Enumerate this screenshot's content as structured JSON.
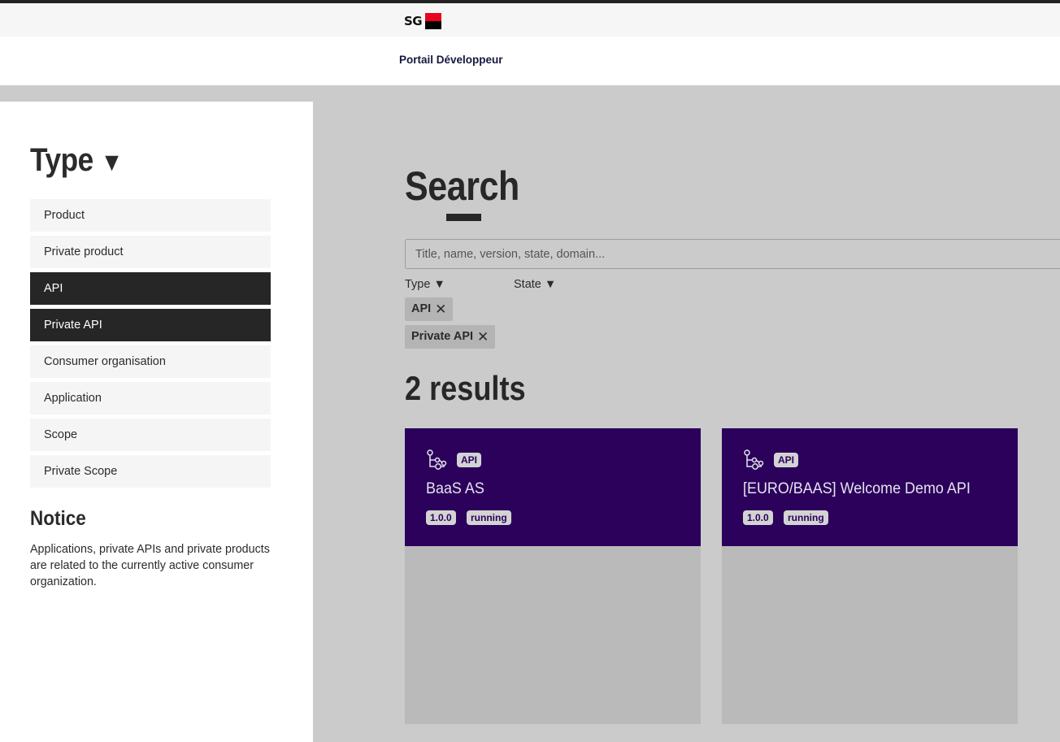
{
  "brand": {
    "logo_text": "SG",
    "portal_title": "Portail Développeur",
    "flag_colors": {
      "top": "#e9041e",
      "bottom": "#000000"
    }
  },
  "sidebar": {
    "heading": "Type",
    "heading_arrow": "▼",
    "items": [
      {
        "label": "Product",
        "active": false
      },
      {
        "label": "Private product",
        "active": false
      },
      {
        "label": "API",
        "active": true
      },
      {
        "label": "Private API",
        "active": true
      },
      {
        "label": "Consumer organisation",
        "active": false
      },
      {
        "label": "Application",
        "active": false
      },
      {
        "label": "Scope",
        "active": false
      },
      {
        "label": "Private Scope",
        "active": false
      }
    ],
    "notice_title": "Notice",
    "notice_text": "Applications, private APIs and private products are related to the currently active consumer organization."
  },
  "main": {
    "title": "Search",
    "search": {
      "placeholder": "Title, name, version, state, domain...",
      "value": ""
    },
    "filters": {
      "type_label": "Type ▼",
      "state_label": "State ▼"
    },
    "chips": [
      {
        "label": "API",
        "remove_icon": "✕"
      },
      {
        "label": "Private API",
        "remove_icon": "✕"
      }
    ],
    "results_count": "2 results",
    "cards": [
      {
        "icon": "api-network-icon",
        "type_badge": "API",
        "title": "BaaS AS",
        "version": "1.0.0",
        "state": "running"
      },
      {
        "icon": "api-network-icon",
        "type_badge": "API",
        "title": "[EURO/BAAS] Welcome Demo API",
        "version": "1.0.0",
        "state": "running"
      }
    ]
  },
  "colors": {
    "card_header": "#2b015c",
    "active_item": "#262626",
    "background": "#cbcbcb"
  }
}
